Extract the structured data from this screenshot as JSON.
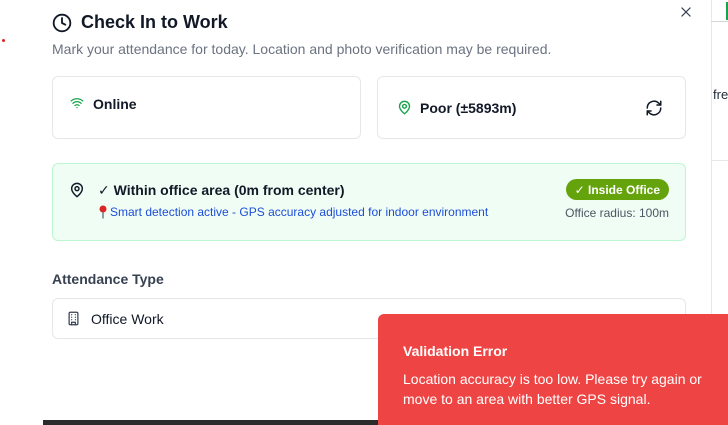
{
  "background": {
    "right_text": "fre"
  },
  "dialog": {
    "title": "Check In to Work",
    "subtitle": "Mark your attendance for today. Location and photo verification may be required.",
    "close_label": "×"
  },
  "status": {
    "network": "Online",
    "gps": "Poor (±5893m)"
  },
  "location": {
    "status": "✓ Within office area (0m from center)",
    "detection": "Smart detection active - GPS accuracy adjusted for indoor environment",
    "badge": "✓ Inside Office",
    "radius": "Office radius: 100m"
  },
  "attendance": {
    "label": "Attendance Type",
    "selected": "Office Work"
  },
  "toast": {
    "title": "Validation Error",
    "message": "Location accuracy is too low. Please try again or move to an area with better GPS signal."
  },
  "colors": {
    "success": "#16a34a",
    "badge": "#65a30d",
    "error": "#ef4444",
    "link": "#1d4ed8"
  },
  "icons": [
    "clock-icon",
    "close-icon",
    "wifi-icon",
    "map-pin-icon",
    "refresh-icon",
    "pushpin-icon",
    "building-icon"
  ]
}
